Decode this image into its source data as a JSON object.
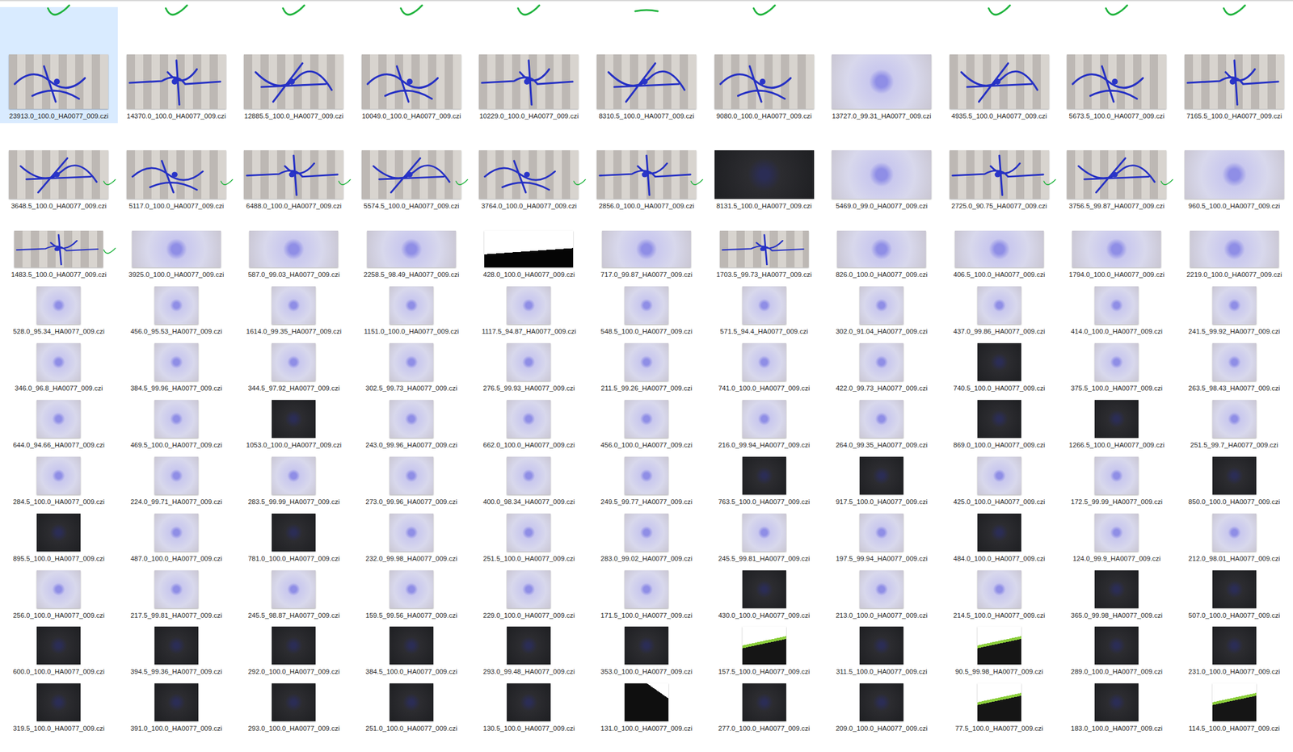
{
  "files": [
    {
      "name": "23913.0_100.0_HA0077_009.czi",
      "kind": "hyphae",
      "selected": true,
      "annotation": "check"
    },
    {
      "name": "14370.0_100.0_HA0077_009.czi",
      "kind": "hyphae",
      "selected": false,
      "annotation": "check"
    },
    {
      "name": "12885.5_100.0_HA0077_009.czi",
      "kind": "hyphae",
      "selected": false,
      "annotation": "check"
    },
    {
      "name": "10049.0_100.0_HA0077_009.czi",
      "kind": "hyphae",
      "selected": false,
      "annotation": "check"
    },
    {
      "name": "10229.0_100.0_HA0077_009.czi",
      "kind": "hyphae",
      "selected": false,
      "annotation": "check"
    },
    {
      "name": "8310.5_100.0_HA0077_009.czi",
      "kind": "hyphae",
      "selected": false,
      "annotation": "dash"
    },
    {
      "name": "9080.0_100.0_HA0077_009.czi",
      "kind": "hyphae",
      "selected": false,
      "annotation": "check"
    },
    {
      "name": "13727.0_99.31_HA0077_009.czi",
      "kind": "light",
      "selected": false,
      "annotation": "none"
    },
    {
      "name": "4935.5_100.0_HA0077_009.czi",
      "kind": "hyphae",
      "selected": false,
      "annotation": "check"
    },
    {
      "name": "5673.5_100.0_HA0077_009.czi",
      "kind": "hyphae",
      "selected": false,
      "annotation": "check"
    },
    {
      "name": "7165.5_100.0_HA0077_009.czi",
      "kind": "hyphae",
      "selected": false,
      "annotation": "check"
    },
    {
      "name": "3648.5_100.0_HA0077_009.czi",
      "kind": "hyphae",
      "selected": false,
      "annotation": "check"
    },
    {
      "name": "5117.0_100.0_HA0077_009.czi",
      "kind": "hyphae",
      "selected": false,
      "annotation": "check"
    },
    {
      "name": "6488.0_100.0_HA0077_009.czi",
      "kind": "hyphae",
      "selected": false,
      "annotation": "check"
    },
    {
      "name": "5574.5_100.0_HA0077_009.czi",
      "kind": "hyphae",
      "selected": false,
      "annotation": "check"
    },
    {
      "name": "3764.0_100.0_HA0077_009.czi",
      "kind": "hyphae",
      "selected": false,
      "annotation": "check"
    },
    {
      "name": "2856.0_100.0_HA0077_009.czi",
      "kind": "hyphae",
      "selected": false,
      "annotation": "check"
    },
    {
      "name": "8131.5_100.0_HA0077_009.czi",
      "kind": "dark",
      "selected": false,
      "annotation": "none"
    },
    {
      "name": "5469.0_99.0_HA0077_009.czi",
      "kind": "light",
      "selected": false,
      "annotation": "none"
    },
    {
      "name": "2725.0_90.75_HA0077_009.czi",
      "kind": "hyphae",
      "selected": false,
      "annotation": "check"
    },
    {
      "name": "3756.5_99.87_HA0077_009.czi",
      "kind": "hyphae",
      "selected": false,
      "annotation": "check"
    },
    {
      "name": "960.5_100.0_HA0077_009.czi",
      "kind": "light",
      "selected": false,
      "annotation": "none"
    },
    {
      "name": "1483.5_100.0_HA0077_009.czi",
      "kind": "hyphae",
      "selected": false,
      "annotation": "check"
    },
    {
      "name": "3925.0_100.0_HA0077_009.czi",
      "kind": "light",
      "selected": false,
      "annotation": "none"
    },
    {
      "name": "587.0_99.03_HA0077_009.czi",
      "kind": "light",
      "selected": false,
      "annotation": "none"
    },
    {
      "name": "2258.5_98.49_HA0077_009.czi",
      "kind": "light",
      "selected": false,
      "annotation": "none"
    },
    {
      "name": "428.0_100.0_HA0077_009.czi",
      "kind": "wedge",
      "selected": false,
      "annotation": "none"
    },
    {
      "name": "717.0_99.87_HA0077_009.czi",
      "kind": "light",
      "selected": false,
      "annotation": "none"
    },
    {
      "name": "1703.5_99.73_HA0077_009.czi",
      "kind": "hyphae",
      "selected": false,
      "annotation": "none"
    },
    {
      "name": "826.0_100.0_HA0077_009.czi",
      "kind": "light",
      "selected": false,
      "annotation": "none"
    },
    {
      "name": "406.5_100.0_HA0077_009.czi",
      "kind": "light",
      "selected": false,
      "annotation": "none"
    },
    {
      "name": "1794.0_100.0_HA0077_009.czi",
      "kind": "light",
      "selected": false,
      "annotation": "none"
    },
    {
      "name": "2219.0_100.0_HA0077_009.czi",
      "kind": "light",
      "selected": false,
      "annotation": "none"
    },
    {
      "name": "528.0_95.34_HA0077_009.czi",
      "kind": "light",
      "selected": false,
      "annotation": "none"
    },
    {
      "name": "456.0_95.53_HA0077_009.czi",
      "kind": "light",
      "selected": false,
      "annotation": "none"
    },
    {
      "name": "1614.0_99.35_HA0077_009.czi",
      "kind": "light",
      "selected": false,
      "annotation": "none"
    },
    {
      "name": "1151.0_100.0_HA0077_009.czi",
      "kind": "light",
      "selected": false,
      "annotation": "none"
    },
    {
      "name": "1117.5_94.87_HA0077_009.czi",
      "kind": "light",
      "selected": false,
      "annotation": "none"
    },
    {
      "name": "548.5_100.0_HA0077_009.czi",
      "kind": "light",
      "selected": false,
      "annotation": "none"
    },
    {
      "name": "571.5_94.4_HA0077_009.czi",
      "kind": "light",
      "selected": false,
      "annotation": "none"
    },
    {
      "name": "302.0_91.04_HA0077_009.czi",
      "kind": "light",
      "selected": false,
      "annotation": "none"
    },
    {
      "name": "437.0_99.86_HA0077_009.czi",
      "kind": "light",
      "selected": false,
      "annotation": "none"
    },
    {
      "name": "414.0_100.0_HA0077_009.czi",
      "kind": "light",
      "selected": false,
      "annotation": "none"
    },
    {
      "name": "241.5_99.92_HA0077_009.czi",
      "kind": "light",
      "selected": false,
      "annotation": "none"
    },
    {
      "name": "346.0_96.8_HA0077_009.czi",
      "kind": "light",
      "selected": false,
      "annotation": "none"
    },
    {
      "name": "384.5_99.96_HA0077_009.czi",
      "kind": "light",
      "selected": false,
      "annotation": "none"
    },
    {
      "name": "344.5_97.92_HA0077_009.czi",
      "kind": "light",
      "selected": false,
      "annotation": "none"
    },
    {
      "name": "302.5_99.73_HA0077_009.czi",
      "kind": "light",
      "selected": false,
      "annotation": "none"
    },
    {
      "name": "276.5_99.93_HA0077_009.czi",
      "kind": "light",
      "selected": false,
      "annotation": "none"
    },
    {
      "name": "211.5_99.26_HA0077_009.czi",
      "kind": "light",
      "selected": false,
      "annotation": "none"
    },
    {
      "name": "741.0_100.0_HA0077_009.czi",
      "kind": "light",
      "selected": false,
      "annotation": "none"
    },
    {
      "name": "422.0_99.73_HA0077_009.czi",
      "kind": "light",
      "selected": false,
      "annotation": "none"
    },
    {
      "name": "740.5_100.0_HA0077_009.czi",
      "kind": "dark",
      "selected": false,
      "annotation": "none"
    },
    {
      "name": "375.5_100.0_HA0077_009.czi",
      "kind": "light",
      "selected": false,
      "annotation": "none"
    },
    {
      "name": "263.5_98.43_HA0077_009.czi",
      "kind": "light",
      "selected": false,
      "annotation": "none"
    },
    {
      "name": "644.0_94.66_HA0077_009.czi",
      "kind": "light",
      "selected": false,
      "annotation": "none"
    },
    {
      "name": "469.5_100.0_HA0077_009.czi",
      "kind": "light",
      "selected": false,
      "annotation": "none"
    },
    {
      "name": "1053.0_100.0_HA0077_009.czi",
      "kind": "dark",
      "selected": false,
      "annotation": "none"
    },
    {
      "name": "243.0_99.96_HA0077_009.czi",
      "kind": "light",
      "selected": false,
      "annotation": "none"
    },
    {
      "name": "662.0_100.0_HA0077_009.czi",
      "kind": "light",
      "selected": false,
      "annotation": "none"
    },
    {
      "name": "456.0_100.0_HA0077_009.czi",
      "kind": "light",
      "selected": false,
      "annotation": "none"
    },
    {
      "name": "216.0_99.94_HA0077_009.czi",
      "kind": "light",
      "selected": false,
      "annotation": "none"
    },
    {
      "name": "264.0_99.35_HA0077_009.czi",
      "kind": "light",
      "selected": false,
      "annotation": "none"
    },
    {
      "name": "869.0_100.0_HA0077_009.czi",
      "kind": "dark",
      "selected": false,
      "annotation": "none"
    },
    {
      "name": "1266.5_100.0_HA0077_009.czi",
      "kind": "dark",
      "selected": false,
      "annotation": "none"
    },
    {
      "name": "251.5_99.7_HA0077_009.czi",
      "kind": "light",
      "selected": false,
      "annotation": "none"
    },
    {
      "name": "284.5_100.0_HA0077_009.czi",
      "kind": "light",
      "selected": false,
      "annotation": "none"
    },
    {
      "name": "224.0_99.71_HA0077_009.czi",
      "kind": "light",
      "selected": false,
      "annotation": "none"
    },
    {
      "name": "283.5_99.99_HA0077_009.czi",
      "kind": "light",
      "selected": false,
      "annotation": "none"
    },
    {
      "name": "273.0_99.96_HA0077_009.czi",
      "kind": "light",
      "selected": false,
      "annotation": "none"
    },
    {
      "name": "400.0_98.34_HA0077_009.czi",
      "kind": "light",
      "selected": false,
      "annotation": "none"
    },
    {
      "name": "249.5_99.77_HA0077_009.czi",
      "kind": "light",
      "selected": false,
      "annotation": "none"
    },
    {
      "name": "763.5_100.0_HA0077_009.czi",
      "kind": "dark",
      "selected": false,
      "annotation": "none"
    },
    {
      "name": "917.5_100.0_HA0077_009.czi",
      "kind": "dark",
      "selected": false,
      "annotation": "none"
    },
    {
      "name": "425.0_100.0_HA0077_009.czi",
      "kind": "light",
      "selected": false,
      "annotation": "none"
    },
    {
      "name": "172.5_99.99_HA0077_009.czi",
      "kind": "light",
      "selected": false,
      "annotation": "none"
    },
    {
      "name": "850.0_100.0_HA0077_009.czi",
      "kind": "dark",
      "selected": false,
      "annotation": "none"
    },
    {
      "name": "895.5_100.0_HA0077_009.czi",
      "kind": "dark",
      "selected": false,
      "annotation": "none"
    },
    {
      "name": "487.0_100.0_HA0077_009.czi",
      "kind": "light",
      "selected": false,
      "annotation": "none"
    },
    {
      "name": "781.0_100.0_HA0077_009.czi",
      "kind": "dark",
      "selected": false,
      "annotation": "none"
    },
    {
      "name": "232.0_99.98_HA0077_009.czi",
      "kind": "light",
      "selected": false,
      "annotation": "none"
    },
    {
      "name": "251.5_100.0_HA0077_009.czi",
      "kind": "light",
      "selected": false,
      "annotation": "none"
    },
    {
      "name": "283.0_99.02_HA0077_009.czi",
      "kind": "light",
      "selected": false,
      "annotation": "none"
    },
    {
      "name": "245.5_99.81_HA0077_009.czi",
      "kind": "light",
      "selected": false,
      "annotation": "none"
    },
    {
      "name": "197.5_99.94_HA0077_009.czi",
      "kind": "light",
      "selected": false,
      "annotation": "none"
    },
    {
      "name": "484.0_100.0_HA0077_009.czi",
      "kind": "dark",
      "selected": false,
      "annotation": "none"
    },
    {
      "name": "124.0_99.9_HA0077_009.czi",
      "kind": "light",
      "selected": false,
      "annotation": "none"
    },
    {
      "name": "212.0_98.01_HA0077_009.czi",
      "kind": "light",
      "selected": false,
      "annotation": "none"
    },
    {
      "name": "256.0_100.0_HA0077_009.czi",
      "kind": "light",
      "selected": false,
      "annotation": "none"
    },
    {
      "name": "217.5_99.81_HA0077_009.czi",
      "kind": "light",
      "selected": false,
      "annotation": "none"
    },
    {
      "name": "245.5_98.87_HA0077_009.czi",
      "kind": "light",
      "selected": false,
      "annotation": "none"
    },
    {
      "name": "159.5_99.56_HA0077_009.czi",
      "kind": "light",
      "selected": false,
      "annotation": "none"
    },
    {
      "name": "229.0_100.0_HA0077_009.czi",
      "kind": "light",
      "selected": false,
      "annotation": "none"
    },
    {
      "name": "171.5_100.0_HA0077_009.czi",
      "kind": "light",
      "selected": false,
      "annotation": "none"
    },
    {
      "name": "430.0_100.0_HA0077_009.czi",
      "kind": "dark",
      "selected": false,
      "annotation": "none"
    },
    {
      "name": "213.0_100.0_HA0077_009.czi",
      "kind": "light",
      "selected": false,
      "annotation": "none"
    },
    {
      "name": "214.5_100.0_HA0077_009.czi",
      "kind": "light",
      "selected": false,
      "annotation": "none"
    },
    {
      "name": "365.0_99.98_HA0077_009.czi",
      "kind": "dark",
      "selected": false,
      "annotation": "none"
    },
    {
      "name": "507.0_100.0_HA0077_009.czi",
      "kind": "dark",
      "selected": false,
      "annotation": "none"
    },
    {
      "name": "600.0_100.0_HA0077_009.czi",
      "kind": "dark",
      "selected": false,
      "annotation": "none"
    },
    {
      "name": "394.5_99.36_HA0077_009.czi",
      "kind": "dark",
      "selected": false,
      "annotation": "none"
    },
    {
      "name": "292.0_100.0_HA0077_009.czi",
      "kind": "dark",
      "selected": false,
      "annotation": "none"
    },
    {
      "name": "384.5_100.0_HA0077_009.czi",
      "kind": "dark",
      "selected": false,
      "annotation": "none"
    },
    {
      "name": "293.0_99.48_HA0077_009.czi",
      "kind": "dark",
      "selected": false,
      "annotation": "none"
    },
    {
      "name": "353.0_100.0_HA0077_009.czi",
      "kind": "dark",
      "selected": false,
      "annotation": "none"
    },
    {
      "name": "157.5_100.0_HA0077_009.czi",
      "kind": "edge",
      "selected": false,
      "annotation": "none"
    },
    {
      "name": "311.5_100.0_HA0077_009.czi",
      "kind": "dark",
      "selected": false,
      "annotation": "none"
    },
    {
      "name": "90.5_99.98_HA0077_009.czi",
      "kind": "edge",
      "selected": false,
      "annotation": "none"
    },
    {
      "name": "289.0_100.0_HA0077_009.czi",
      "kind": "dark",
      "selected": false,
      "annotation": "none"
    },
    {
      "name": "231.0_100.0_HA0077_009.czi",
      "kind": "dark",
      "selected": false,
      "annotation": "none"
    },
    {
      "name": "319.5_100.0_HA0077_009.czi",
      "kind": "dark",
      "selected": false,
      "annotation": "none"
    },
    {
      "name": "391.0_100.0_HA0077_009.czi",
      "kind": "dark",
      "selected": false,
      "annotation": "none"
    },
    {
      "name": "293.0_100.0_HA0077_009.czi",
      "kind": "dark",
      "selected": false,
      "annotation": "none"
    },
    {
      "name": "251.0_100.0_HA0077_009.czi",
      "kind": "dark",
      "selected": false,
      "annotation": "none"
    },
    {
      "name": "130.5_100.0_HA0077_009.czi",
      "kind": "dark",
      "selected": false,
      "annotation": "none"
    },
    {
      "name": "131.0_100.0_HA0077_009.czi",
      "kind": "corner",
      "selected": false,
      "annotation": "none"
    },
    {
      "name": "277.0_100.0_HA0077_009.czi",
      "kind": "dark",
      "selected": false,
      "annotation": "none"
    },
    {
      "name": "209.0_100.0_HA0077_009.czi",
      "kind": "dark",
      "selected": false,
      "annotation": "none"
    },
    {
      "name": "77.5_100.0_HA0077_009.czi",
      "kind": "edge",
      "selected": false,
      "annotation": "none"
    },
    {
      "name": "183.0_100.0_HA0077_009.czi",
      "kind": "dark",
      "selected": false,
      "annotation": "none"
    },
    {
      "name": "114.5_100.0_HA0077_009.czi",
      "kind": "edge",
      "selected": false,
      "annotation": "none"
    }
  ]
}
